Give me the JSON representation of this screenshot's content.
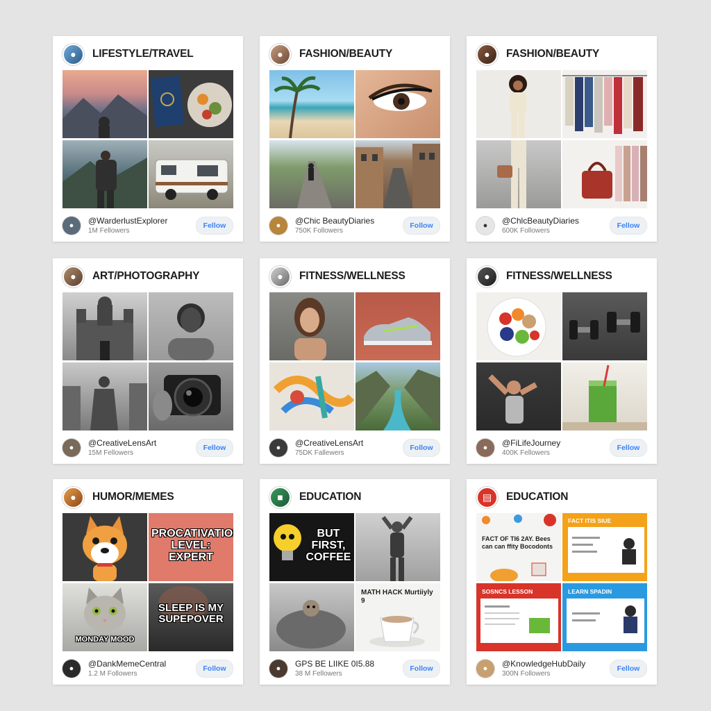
{
  "colors": {
    "background": "#e4e4e4",
    "card": "#ffffff",
    "follow_text": "#3b82f6",
    "follow_bg": "#eef1f4"
  },
  "cards": [
    {
      "category": "LIFESTYLE/TRAVEL",
      "handle": "@WarderlustExplorer",
      "followers": "1M Fellowers",
      "follow_label": "Fellow",
      "avatar_icon": "person-icon",
      "tiles": [
        {
          "icon": "mountain-sunset-icon",
          "caption": ""
        },
        {
          "icon": "passport-food-icon",
          "caption": ""
        },
        {
          "icon": "hiker-backpack-icon",
          "caption": ""
        },
        {
          "icon": "camper-van-icon",
          "caption": ""
        }
      ]
    },
    {
      "category": "FASHION/BEAUTY",
      "handle": "@Chic BeautyDiaries",
      "followers": "750K Followers",
      "follow_label": "Follow",
      "avatar_icon": "woman-icon",
      "tiles": [
        {
          "icon": "palm-beach-icon",
          "caption": ""
        },
        {
          "icon": "eyeliner-closeup-icon",
          "caption": ""
        },
        {
          "icon": "path-walker-icon",
          "caption": ""
        },
        {
          "icon": "city-street-icon",
          "caption": ""
        }
      ]
    },
    {
      "category": "FASHION/BEAUTY",
      "handle": "@ChlcBeautyDiaries",
      "followers": "600K Followers",
      "follow_label": "Fellow",
      "avatar_icon": "woman-icon",
      "tiles": [
        {
          "icon": "fashion-model-icon",
          "caption": ""
        },
        {
          "icon": "clothing-rack-icon",
          "caption": ""
        },
        {
          "icon": "handbag-model-icon",
          "caption": ""
        },
        {
          "icon": "dress-rack-icon",
          "caption": ""
        }
      ]
    },
    {
      "category": "ART/PHOTOGRAPHY",
      "handle": "@CreativeLensArt",
      "followers": "15M Fellowers",
      "follow_label": "Fellow",
      "avatar_icon": "person-icon",
      "tiles": [
        {
          "icon": "cathedral-bw-icon",
          "caption": ""
        },
        {
          "icon": "portrait-bw-icon",
          "caption": ""
        },
        {
          "icon": "statue-bw-icon",
          "caption": ""
        },
        {
          "icon": "camera-lens-icon",
          "caption": ""
        }
      ]
    },
    {
      "category": "FITNESS/WELLNESS",
      "handle": "@CreativeLensArt",
      "followers": "75DK Fallewers",
      "follow_label": "Follow",
      "avatar_icon": "person-icon",
      "tiles": [
        {
          "icon": "portrait-woman-icon",
          "caption": ""
        },
        {
          "icon": "running-shoe-icon",
          "caption": ""
        },
        {
          "icon": "abstract-painting-icon",
          "caption": ""
        },
        {
          "icon": "mountain-river-icon",
          "caption": ""
        }
      ]
    },
    {
      "category": "FITNESS/WELLNESS",
      "handle": "@FiLifeJourney",
      "followers": "400K Fellowers",
      "follow_label": "Fellow",
      "avatar_icon": "person-icon",
      "tiles": [
        {
          "icon": "fruit-bowl-icon",
          "caption": ""
        },
        {
          "icon": "dumbbells-icon",
          "caption": ""
        },
        {
          "icon": "athlete-flex-icon",
          "caption": ""
        },
        {
          "icon": "green-smoothie-icon",
          "caption": ""
        }
      ]
    },
    {
      "category": "HUMOR/MEMES",
      "handle": "@DankMemeCentral",
      "followers": "1.2 M Followers",
      "follow_label": "Follow",
      "avatar_icon": "dog-icon",
      "tiles": [
        {
          "icon": "cartoon-dog-icon",
          "caption": ""
        },
        {
          "icon": "",
          "caption": "PROCATIVATION LEVEL: EXPERT"
        },
        {
          "icon": "cat-icon",
          "caption": "MONDAY MOOD"
        },
        {
          "icon": "",
          "caption": "SLEEP IS MY SUPEPOVER"
        }
      ]
    },
    {
      "category": "EDUCATION",
      "handle": "GPS BE LIIKE 0I5.88",
      "followers": "38 M Fellowers",
      "follow_label": "Follow",
      "avatar_icon": "person-icon",
      "tiles": [
        {
          "icon": "lightbulb-icon",
          "caption": "BUT FIRST, COFFEE"
        },
        {
          "icon": "statue-pose-icon",
          "caption": ""
        },
        {
          "icon": "blanket-pet-icon",
          "caption": ""
        },
        {
          "icon": "coffee-cup-icon",
          "caption": "MATH HACK Murtiiyly 9"
        }
      ]
    },
    {
      "category": "EDUCATION",
      "handle": "@KnowledgeHubDaily",
      "followers": "300N Followers",
      "follow_label": "Fellow",
      "avatar_icon": "book-icon",
      "tiles": [
        {
          "icon": "infographic-icon",
          "caption": "FACT OF TI6 2AY. Bees can can ffity Bocodonts"
        },
        {
          "icon": "infographic-icon",
          "caption": "FACT ITIS SIUE"
        },
        {
          "icon": "infographic-icon",
          "caption": "SOSNCS LESSON"
        },
        {
          "icon": "infographic-icon",
          "caption": "LEARN SPADIN"
        }
      ]
    }
  ]
}
